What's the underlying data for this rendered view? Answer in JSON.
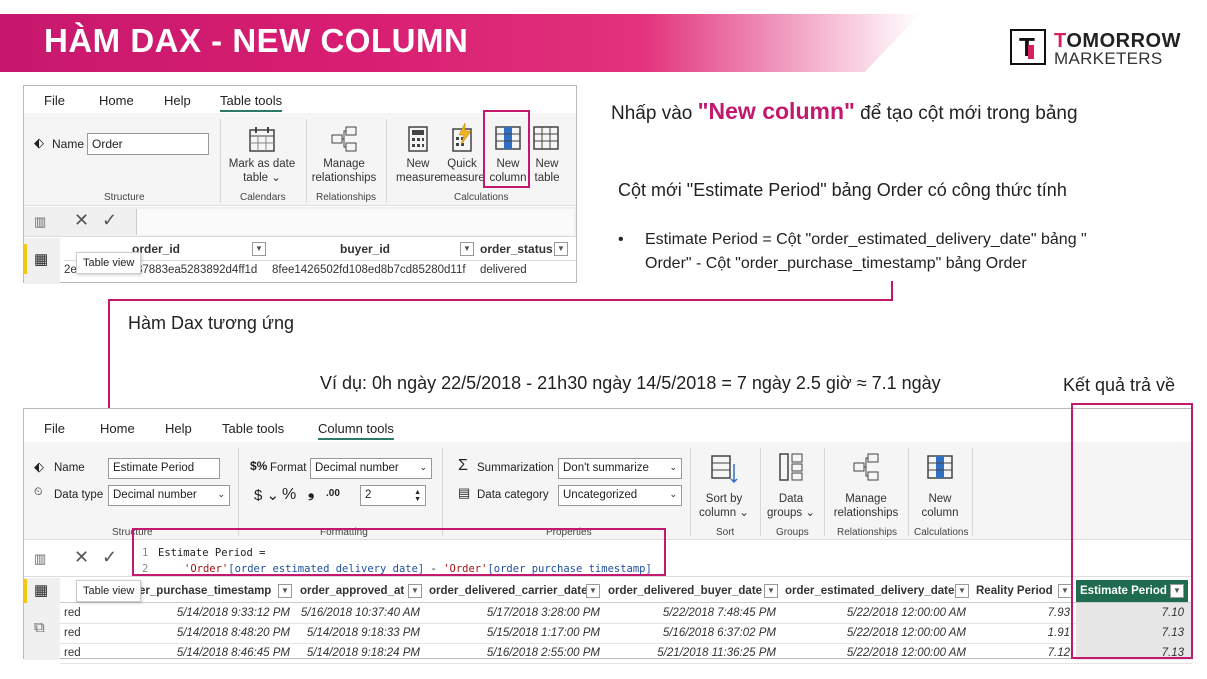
{
  "banner": {
    "title": "HÀM DAX - NEW COLUMN"
  },
  "logo": {
    "mark": "T",
    "line1_a": "T",
    "line1_b": "OMORROW",
    "line2": "MARKETERS"
  },
  "shot1": {
    "menu": [
      "File",
      "Home",
      "Help",
      "Table tools"
    ],
    "name_label": "Name",
    "name_value": "Order",
    "structure_label": "Structure",
    "btn_mark_date": "Mark as date",
    "btn_mark_date2": "table",
    "calendars_label": "Calendars",
    "btn_manage": "Manage",
    "btn_manage2": "relationships",
    "relationships_label": "Relationships",
    "btn_new_measure": "New",
    "btn_new_measure2": "measure",
    "btn_quick": "Quick",
    "btn_quick2": "measure",
    "btn_new_column": "New",
    "btn_new_column2": "column",
    "btn_new_table": "New",
    "btn_new_table2": "table",
    "calculations_label": "Calculations",
    "tooltip": "Table view",
    "headers": [
      "order_id",
      "buyer_id",
      "order_status"
    ],
    "row": [
      "37883ea5283892d4ff1d",
      "8fee1426502fd108ed8b7cd85280d11f",
      "delivered"
    ],
    "row_prefix": "2e"
  },
  "notes": {
    "click_prefix": "Nhấp vào ",
    "click_quote_open": "\"",
    "click_bold": "New column",
    "click_quote_close": "\"",
    "click_suffix": " để tạo cột mới trong bảng",
    "new_col_desc": "Cột mới \"Estimate Period\" bảng Order có công thức tính",
    "bullet": "•",
    "formula_line1": "Estimate Period = Cột \"order_estimated_delivery_date\" bảng \"",
    "formula_line2": "Order\" -  Cột \"order_purchase_timestamp\" bảng Order",
    "dax_label": "Hàm Dax tương ứng",
    "example": "Ví dụ: 0h ngày 22/5/2018 - 21h30 ngày 14/5/2018 = 7 ngày 2.5 giờ ≈ 7.1 ngày",
    "result_label": "Kết quả trả về"
  },
  "shot2": {
    "menu": [
      "File",
      "Home",
      "Help",
      "Table tools",
      "Column tools"
    ],
    "name_label": "Name",
    "name_value": "Estimate Period",
    "datatype_label": "Data type",
    "datatype_value": "Decimal number",
    "format_label": "Format",
    "format_value": "Decimal number",
    "decimals_value": "2",
    "dollar": "$",
    "percent": "%",
    "comma": "❟",
    "decimal_icon": ".00",
    "summarization_label": "Summarization",
    "summarization_value": "Don't summarize",
    "category_label": "Data category",
    "category_value": "Uncategorized",
    "sort_label": "Sort by",
    "sort_label2": "column",
    "sort_group": "Sort",
    "data_groups": "Data",
    "data_groups2": "groups",
    "groups_group": "Groups",
    "manage": "Manage",
    "manage2": "relationships",
    "relationships_group": "Relationships",
    "new_col": "New",
    "new_col2": "column",
    "calculations_group": "Calculations",
    "structure_group": "Structure",
    "formatting_group": "Formatting",
    "properties_group": "Properties",
    "code_ln1": "1",
    "code_line1": "Estimate Period =",
    "code_ln2": "2",
    "code_tbl1": "'Order'",
    "code_col1": "[order_estimated_delivery_date]",
    "code_minus": " - ",
    "code_tbl2": "'Order'",
    "code_col2": "[order_purchase_timestamp]",
    "tooltip": "Table view",
    "headers": [
      "der_purchase_timestamp",
      "order_approved_at",
      "order_delivered_carrier_date",
      "order_delivered_buyer_date",
      "order_estimated_delivery_date",
      "Reality Period",
      "Estimate Period"
    ],
    "rows": [
      {
        "prefix": "red",
        "c1": "5/14/2018 9:33:12 PM",
        "c2": "5/16/2018 10:37:40 AM",
        "c3": "5/17/2018 3:28:00 PM",
        "c4": "5/22/2018 7:48:45 PM",
        "c5": "5/22/2018 12:00:00 AM",
        "c6": "7.93",
        "c7": "7.10"
      },
      {
        "prefix": "red",
        "c1": "5/14/2018 8:48:20 PM",
        "c2": "5/14/2018 9:18:33 PM",
        "c3": "5/15/2018 1:17:00 PM",
        "c4": "5/16/2018 6:37:02 PM",
        "c5": "5/22/2018 12:00:00 AM",
        "c6": "1.91",
        "c7": "7.13"
      },
      {
        "prefix": "red",
        "c1": "5/14/2018 8:46:45 PM",
        "c2": "5/14/2018 9:18:24 PM",
        "c3": "5/16/2018 2:55:00 PM",
        "c4": "5/21/2018 11:36:25 PM",
        "c5": "5/22/2018 12:00:00 AM",
        "c6": "7.12",
        "c7": "7.13"
      }
    ]
  }
}
